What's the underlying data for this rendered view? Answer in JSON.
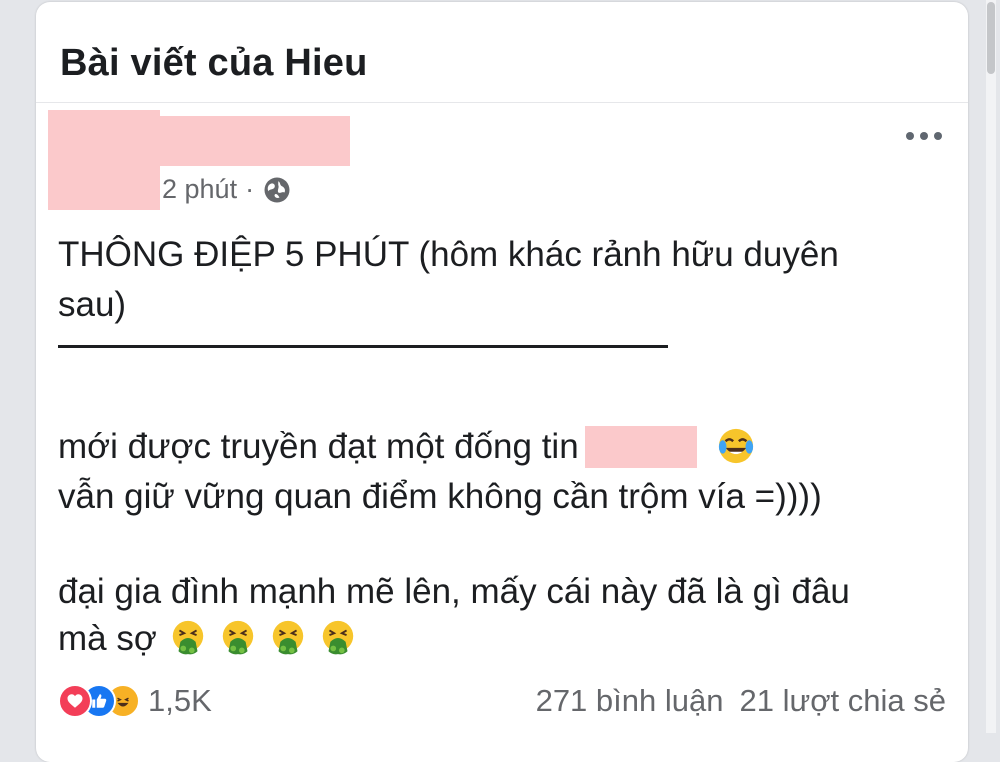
{
  "header": {
    "title": "Bài viết của Hieu"
  },
  "post": {
    "time": "2 phút",
    "separator": "·",
    "privacy_icon": "globe-icon",
    "more_icon": "more-options-icon",
    "line1": "THÔNG ĐIỆP 5 PHÚT (hôm khác rảnh hữu duyên\nsau)",
    "line2_rule": "________________________",
    "line3_before_redaction": "mới được truyền đạt một đống tin",
    "line3_emoji": "face-with-tears-of-joy-emoji",
    "line4": "vẫn giữ vững quan điểm không cần trộm vía =))))",
    "line5": "đại gia đình mạnh mẽ lên, mấy cái này đã là gì đâu",
    "line6": "mà sợ",
    "line6_emojis": [
      "vomiting-face-emoji",
      "vomiting-face-emoji",
      "vomiting-face-emoji",
      "vomiting-face-emoji"
    ]
  },
  "footer": {
    "reaction_icons": [
      "love-reaction-icon",
      "like-reaction-icon",
      "haha-reaction-icon"
    ],
    "reaction_count": "1,5K",
    "comments": "271 bình luận",
    "shares": "21 lượt chia sẻ"
  },
  "colors": {
    "redaction": "#fbc9cb",
    "love": "#f33e58",
    "like": "#1877f2",
    "haha": "#f7b125",
    "muted_text": "#65676b"
  }
}
